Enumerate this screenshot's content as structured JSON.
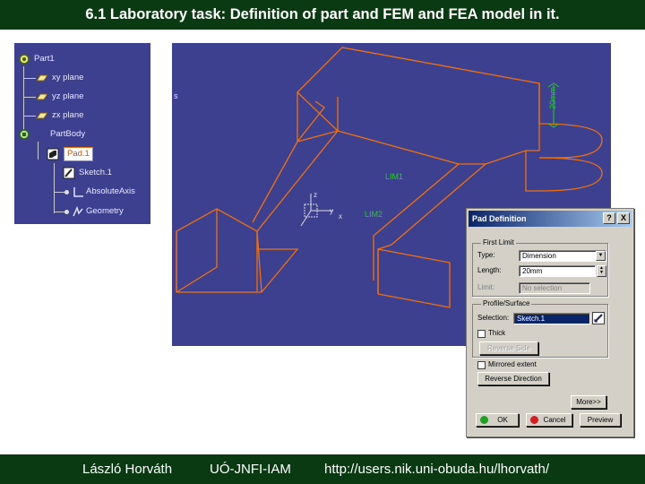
{
  "slide": {
    "title": "6.1 Laboratory task: Definition of part and FEM and FEA model in it.",
    "footer": {
      "author": "László Horváth",
      "institute": "UÓ-JNFI-IAM",
      "url": "http://users.nik.uni-obuda.hu/lhorvath/"
    }
  },
  "colors": {
    "banner": "#0a3a12",
    "viewport_bg": "#3d3f8f",
    "geometry": "#f07010",
    "axis": "#20d020"
  },
  "spec_tree": {
    "items": [
      {
        "label": "Part1",
        "icon": "part-icon"
      },
      {
        "label": "xy plane",
        "icon": "plane-icon"
      },
      {
        "label": "yz plane",
        "icon": "plane-icon"
      },
      {
        "label": "zx plane",
        "icon": "plane-icon"
      },
      {
        "label": "PartBody",
        "icon": "body-icon"
      },
      {
        "label": "Pad.1",
        "icon": "pad-icon",
        "selected": true
      },
      {
        "label": "Sketch.1",
        "icon": "sketch-icon"
      },
      {
        "label": "AbsoluteAxis",
        "icon": "axis-icon"
      },
      {
        "label": "Geometry",
        "icon": "geometry-icon"
      }
    ]
  },
  "viewport": {
    "edge_label": "s",
    "dimension_1": "LIM1",
    "dimension_2": "LIM2",
    "axis_x": "x",
    "axis_y": "y",
    "axis_z": "z",
    "dimension_value": "20mm"
  },
  "dialog": {
    "title": "Pad Definition",
    "help_btn": "?",
    "close_btn": "X",
    "first_limit": {
      "group_label": "First Limit",
      "type_label": "Type:",
      "type_value": "Dimension",
      "length_label": "Length:",
      "length_value": "20mm",
      "limit_label": "Limit:",
      "limit_value": "No selection"
    },
    "profile": {
      "group_label": "Profile/Surface",
      "selection_label": "Selection:",
      "selection_value": "Sketch.1",
      "thick_label": "Thick",
      "reverse_side": "Reverse Side"
    },
    "mirrored_extent": "Mirrored extent",
    "reverse_direction": "Reverse Direction",
    "more": "More>>",
    "ok": "OK",
    "cancel": "Cancel",
    "preview": "Preview"
  }
}
